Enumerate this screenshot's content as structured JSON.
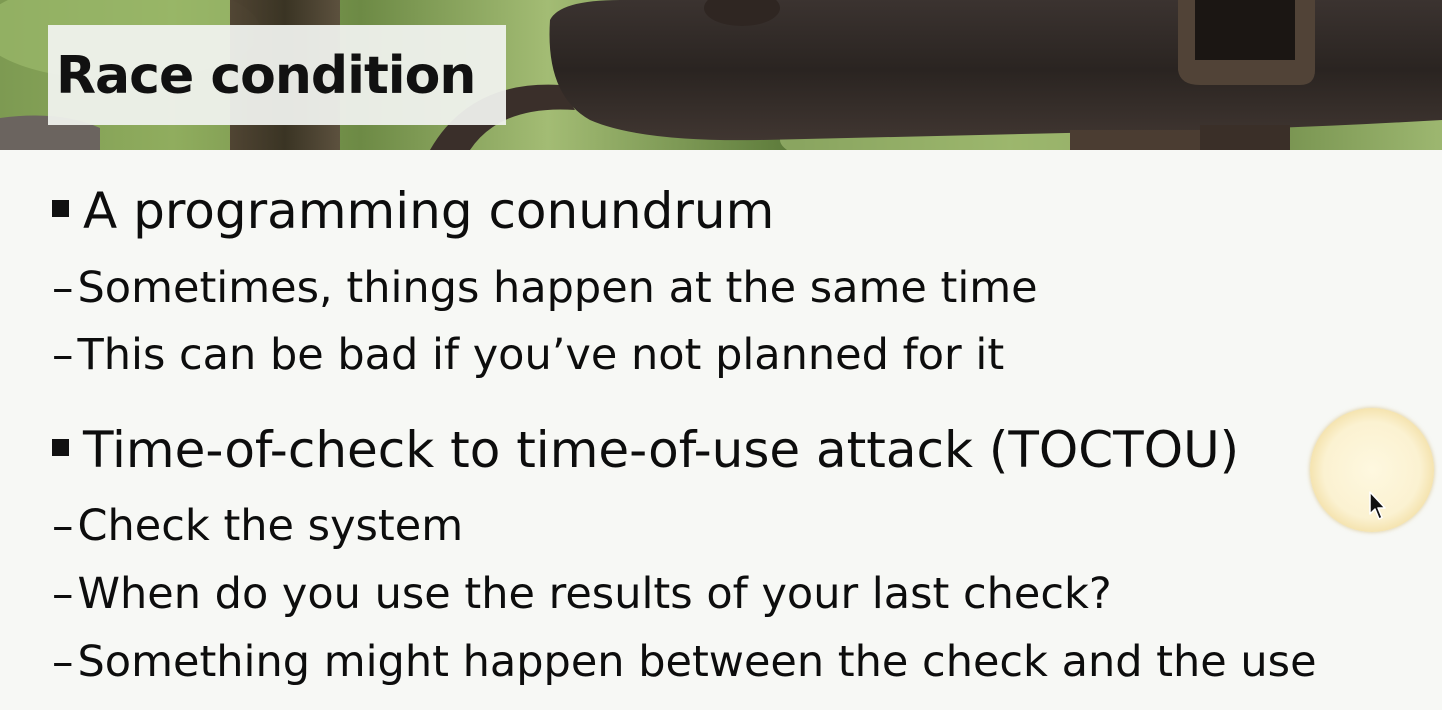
{
  "slide": {
    "title": "Race condition",
    "bullets": [
      {
        "level": 1,
        "text": "A programming conundrum"
      },
      {
        "level": 2,
        "text": "Sometimes, things happen at the same time"
      },
      {
        "level": 2,
        "text": "This can be bad if you’ve not planned for it"
      },
      {
        "level": 1,
        "text": "Time-of-check to time-of-use attack (TOCTOU)"
      },
      {
        "level": 2,
        "text": "Check the system"
      },
      {
        "level": 2,
        "text": "When do you use the results of your last check?"
      },
      {
        "level": 2,
        "text": "Something might happen between the check and the use"
      }
    ],
    "markers": {
      "dash": "–"
    }
  },
  "colors": {
    "background": "#f7f8f5",
    "text": "#0d0d0d",
    "title_box": "#f0f2ee",
    "cursor_highlight": "#f0d68c"
  },
  "icons": {
    "bullet": "square-bullet-icon",
    "cursor": "mouse-pointer-icon"
  }
}
